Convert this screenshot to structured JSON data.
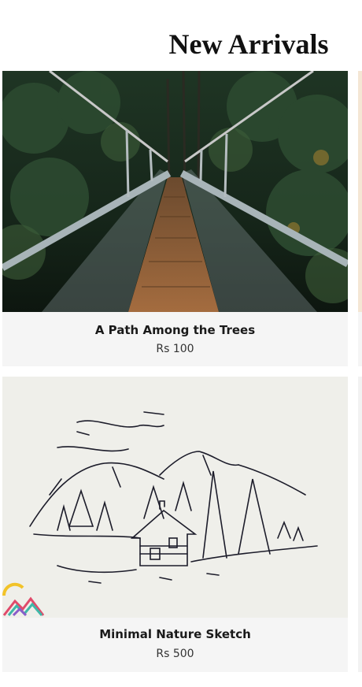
{
  "page": {
    "title": "New Arrivals"
  },
  "products": [
    {
      "name": "A Path Among the Trees",
      "price": "Rs 100"
    },
    {
      "name": "Minimal Nature Sketch",
      "price": "Rs 500"
    }
  ],
  "icons": {
    "card1_image": "suspension-bridge-forest-photo",
    "card2_image": "cabin-mountain-sketch",
    "card2_logo": "mountain-logo-icon"
  },
  "colors": {
    "card_background": "#f5f5f5",
    "text_primary": "#1a1a1a"
  }
}
